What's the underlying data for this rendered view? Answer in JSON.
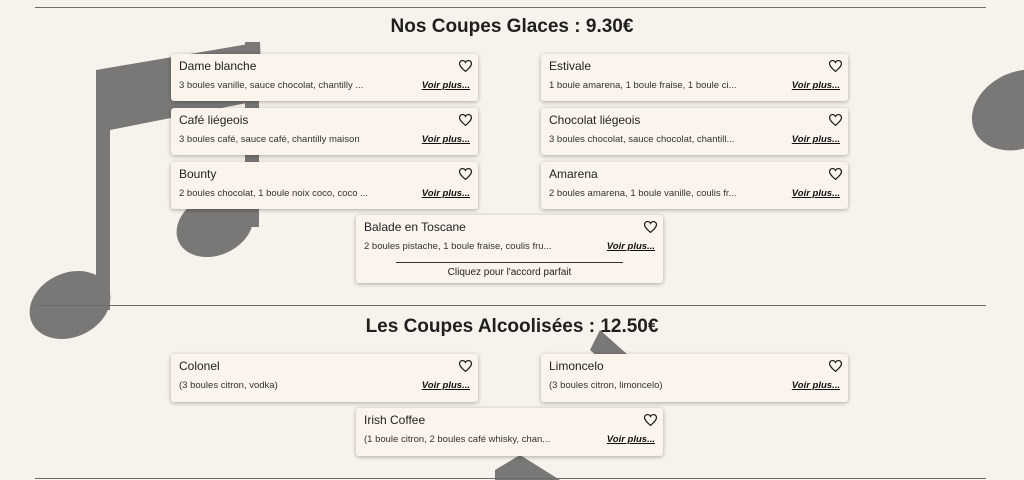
{
  "sections": [
    {
      "title": "Nos Coupes Glaces : 9.30€",
      "items": [
        {
          "name": "Dame blanche",
          "desc": "3 boules vanille, sauce chocolat, chantilly ...",
          "more": "Voir plus..."
        },
        {
          "name": "Estivale",
          "desc": "1 boule amarena, 1 boule fraise, 1 boule ci...",
          "more": "Voir plus..."
        },
        {
          "name": "Café liégeois",
          "desc": "3 boules café, sauce café, chantilly maison",
          "more": "Voir plus..."
        },
        {
          "name": "Chocolat liégeois",
          "desc": "3 boules chocolat, sauce chocolat, chantill...",
          "more": "Voir plus..."
        },
        {
          "name": "Bounty",
          "desc": "2 boules chocolat, 1 boule noix coco, coco ...",
          "more": "Voir plus..."
        },
        {
          "name": "Amarena",
          "desc": "2 boules amarena, 1 boule vanille, coulis fr...",
          "more": "Voir plus..."
        },
        {
          "name": "Balade en Toscane",
          "desc": "2 boules pistache, 1 boule fraise, coulis fru...",
          "more": "Voir plus...",
          "cta": "Cliquez pour l'accord parfait"
        }
      ]
    },
    {
      "title": "Les Coupes Alcoolisées : 12.50€",
      "items": [
        {
          "name": "Colonel",
          "desc": "(3 boules citron, vodka)",
          "more": "Voir plus..."
        },
        {
          "name": "Limoncelo",
          "desc": "(3 boules citron, limoncelo)",
          "more": "Voir plus..."
        },
        {
          "name": "Irish Coffee",
          "desc": "(1 boule citron, 2 boules café whisky, chan...",
          "more": "Voir plus..."
        }
      ]
    }
  ]
}
